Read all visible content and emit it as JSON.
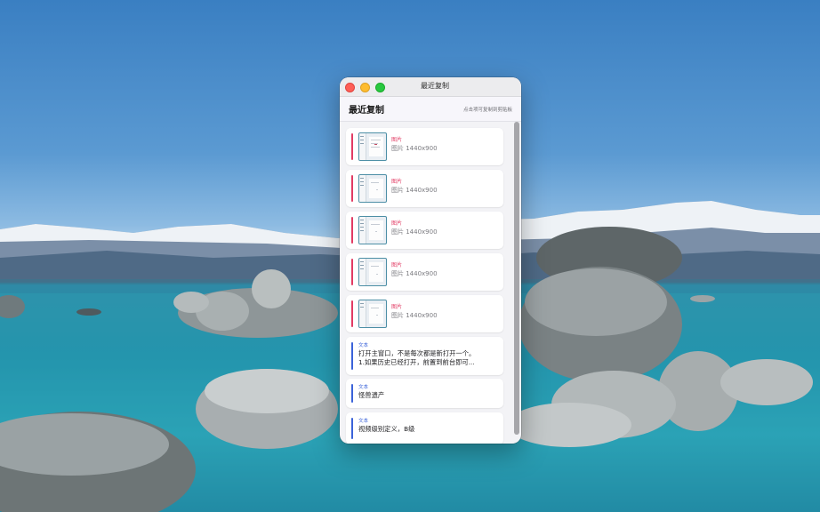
{
  "window": {
    "title": "最近复制",
    "header_title": "最近复制",
    "header_hint": "点击项可复制到剪贴板"
  },
  "items": [
    {
      "type": "image",
      "type_label": "图片",
      "desc": "图片 1440x900"
    },
    {
      "type": "image",
      "type_label": "图片",
      "desc": "图片 1440x900"
    },
    {
      "type": "image",
      "type_label": "图片",
      "desc": "图片 1440x900"
    },
    {
      "type": "image",
      "type_label": "图片",
      "desc": "图片 1440x900"
    },
    {
      "type": "image",
      "type_label": "图片",
      "desc": "图片 1440x900"
    },
    {
      "type": "text",
      "type_label": "文本",
      "line1": "打开主窗口，不是每次都是新打开一个。",
      "line2": "1.如果历史已经打开，前置到前台即可..."
    },
    {
      "type": "text",
      "type_label": "文本",
      "line1": "怪兽遗产"
    },
    {
      "type": "text",
      "type_label": "文本",
      "line1": "视频级别定义，B级"
    }
  ],
  "colors": {
    "image_accent": "#e23c64",
    "text_accent": "#3b63d9",
    "close": "#fe5f57",
    "minimize": "#febc2e",
    "zoom": "#28c840"
  }
}
